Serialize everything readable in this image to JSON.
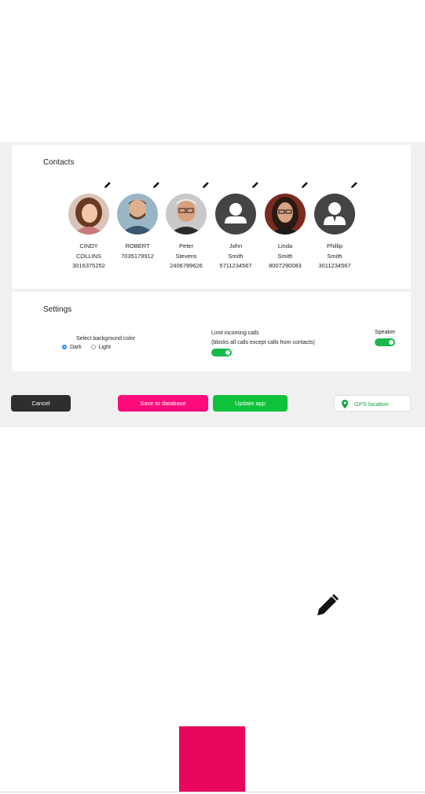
{
  "contacts_section": {
    "title": "Contacts",
    "people": [
      {
        "line1": "CINDY",
        "line2": "COLLINS",
        "phone": "3016375252",
        "avatar": "photo-woman-smiling"
      },
      {
        "line1": "ROBERT",
        "line2": "",
        "phone": "7035179912",
        "avatar": "photo-man-beard"
      },
      {
        "line1": "Peter",
        "line2": "Stevens",
        "phone": "2406789626",
        "avatar": "photo-man-glasses"
      },
      {
        "line1": "John",
        "line2": "Smith",
        "phone": "5711234567",
        "avatar": "placeholder-person-icon"
      },
      {
        "line1": "Linda",
        "line2": "Smith",
        "phone": "8007290083",
        "avatar": "photo-woman-glasses"
      },
      {
        "line1": "Phillip",
        "line2": "Smith",
        "phone": "3011234567",
        "avatar": "placeholder-businessman-icon"
      }
    ]
  },
  "settings_section": {
    "title": "Settings",
    "background_color_label": "Select background color",
    "option_dark": "Dark",
    "option_light": "Light",
    "selected_option": "Dark",
    "limit_calls_label": "Limit incoming calls",
    "limit_calls_sub": "(blocks all calls except calls from contacts)",
    "limit_calls_on": true,
    "speaker_label": "Speaker",
    "speaker_on": true
  },
  "actions": {
    "cancel": "Cancel",
    "save": "Save to database",
    "update": "Update app",
    "gps": "GPS location"
  },
  "colors": {
    "cancel": "#2e2e2e",
    "save": "#ff0a7a",
    "update": "#0fc23b",
    "gps_text": "#0fa33a",
    "toggle_on": "#19b84a",
    "radio_selected": "#1e88ff",
    "accent_square": "#e8075d"
  }
}
